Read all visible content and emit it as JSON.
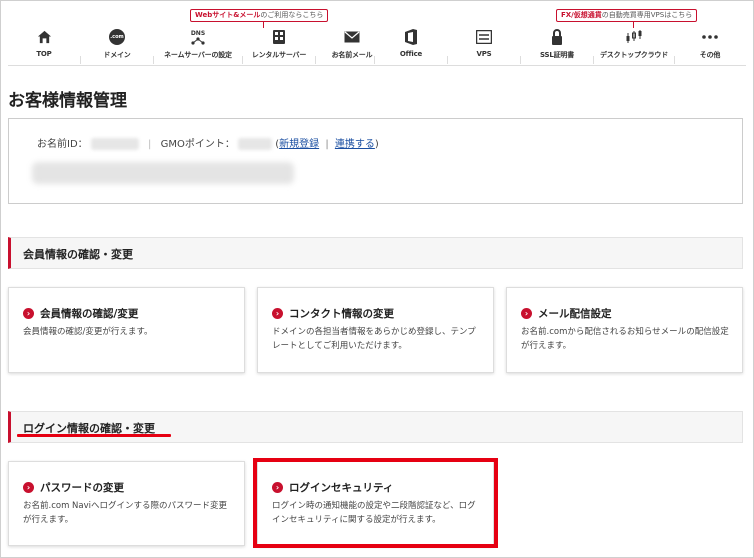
{
  "nav": {
    "items": [
      {
        "label": "TOP",
        "icon": "home-icon"
      },
      {
        "label": "ドメイン",
        "icon": "dotcom-icon"
      },
      {
        "label": "ネームサーバーの設定",
        "icon": "dns-icon"
      },
      {
        "label": "レンタルサーバー",
        "icon": "server-icon"
      },
      {
        "label": "お名前メール",
        "icon": "mail-icon"
      },
      {
        "label": "Office",
        "icon": "office-icon"
      },
      {
        "label": "VPS",
        "icon": "vps-icon"
      },
      {
        "label": "SSL証明書",
        "icon": "lock-icon"
      },
      {
        "label": "デスクトップクラウド",
        "icon": "chart-candle-icon"
      },
      {
        "label": "その他",
        "icon": "more-icon"
      }
    ],
    "promo_server": {
      "bold": "Webサイト&メール",
      "rest": "のご利用ならこちら"
    },
    "promo_fx": {
      "bold": "FX/仮想通貨",
      "rest": "の自動売買専用VPSはこちら"
    },
    "dotcom_glyph": ".com",
    "dns_glyph": "DNS"
  },
  "page": {
    "title": "お客様情報管理"
  },
  "account": {
    "id_label": "お名前ID：",
    "sep1": "|",
    "points_label": "GMOポイント：",
    "open_paren": "(",
    "register_link": "新規登録",
    "sep2": "|",
    "link_link": "連携する",
    "close_paren": ")"
  },
  "sections": {
    "member": "会員情報の確認・変更",
    "login": "ログイン情報の確認・変更"
  },
  "member_cards": [
    {
      "title": "会員情報の確認/変更",
      "desc": "会員情報の確認/変更が行えます。"
    },
    {
      "title": "コンタクト情報の変更",
      "desc": "ドメインの各担当者情報をあらかじめ登録し、テンプレートとしてご利用いただけます。"
    },
    {
      "title": "メール配信設定",
      "desc": "お名前.comから配信されるお知らせメールの配信設定が行えます。"
    }
  ],
  "login_cards": [
    {
      "title": "パスワードの変更",
      "desc": "お名前.com Naviへログインする際のパスワード変更が行えます。"
    },
    {
      "title": "ログインセキュリティ",
      "desc": "ログイン時の通知機能の設定や二段階認証など、ログインセキュリティに関する設定が行えます。"
    }
  ],
  "colors": {
    "accent": "#c8102e",
    "highlight": "#e60012",
    "link": "#1a4ea1"
  }
}
